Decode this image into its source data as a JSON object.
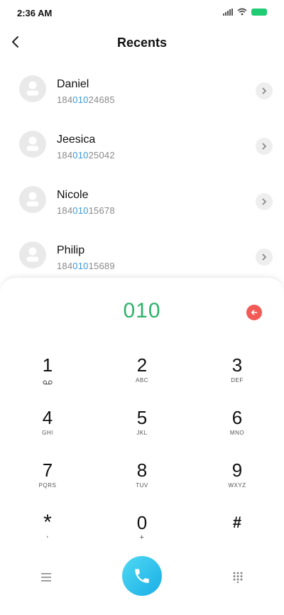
{
  "status": {
    "time": "2:36 AM"
  },
  "header": {
    "title": "Recents"
  },
  "contacts": [
    {
      "name": "Daniel",
      "num_pre": "184",
      "num_match": "010",
      "num_post": "24685"
    },
    {
      "name": "Jeesica",
      "num_pre": "184",
      "num_match": "010",
      "num_post": "25042"
    },
    {
      "name": "Nicole",
      "num_pre": "184",
      "num_match": "010",
      "num_post": "15678"
    },
    {
      "name": "Philip",
      "num_pre": "184",
      "num_match": "010",
      "num_post": "15689"
    }
  ],
  "dialer": {
    "display": "010",
    "keys": [
      {
        "digit": "1",
        "letters": ""
      },
      {
        "digit": "2",
        "letters": "ABC"
      },
      {
        "digit": "3",
        "letters": "DEF"
      },
      {
        "digit": "4",
        "letters": "GHI"
      },
      {
        "digit": "5",
        "letters": "JKL"
      },
      {
        "digit": "6",
        "letters": "MNO"
      },
      {
        "digit": "7",
        "letters": "PQRS"
      },
      {
        "digit": "8",
        "letters": "TUV"
      },
      {
        "digit": "9",
        "letters": "WXYZ"
      },
      {
        "digit": "*",
        "letters": ","
      },
      {
        "digit": "0",
        "letters": "+"
      },
      {
        "digit": "#",
        "letters": ""
      }
    ]
  },
  "icons": {
    "back": "back-arrow-icon",
    "chevron": "chevron-right-icon",
    "backspace": "backspace-icon",
    "voicemail": "voicemail-icon",
    "menu": "menu-icon",
    "call": "phone-icon",
    "keypad": "keypad-grid-icon"
  },
  "colors": {
    "accent_green": "#2fb36b",
    "highlight_blue": "#3a98d8",
    "backspace_red": "#f25a56",
    "call_cyan": "#1aaee6",
    "battery_green": "#1fcb73"
  }
}
